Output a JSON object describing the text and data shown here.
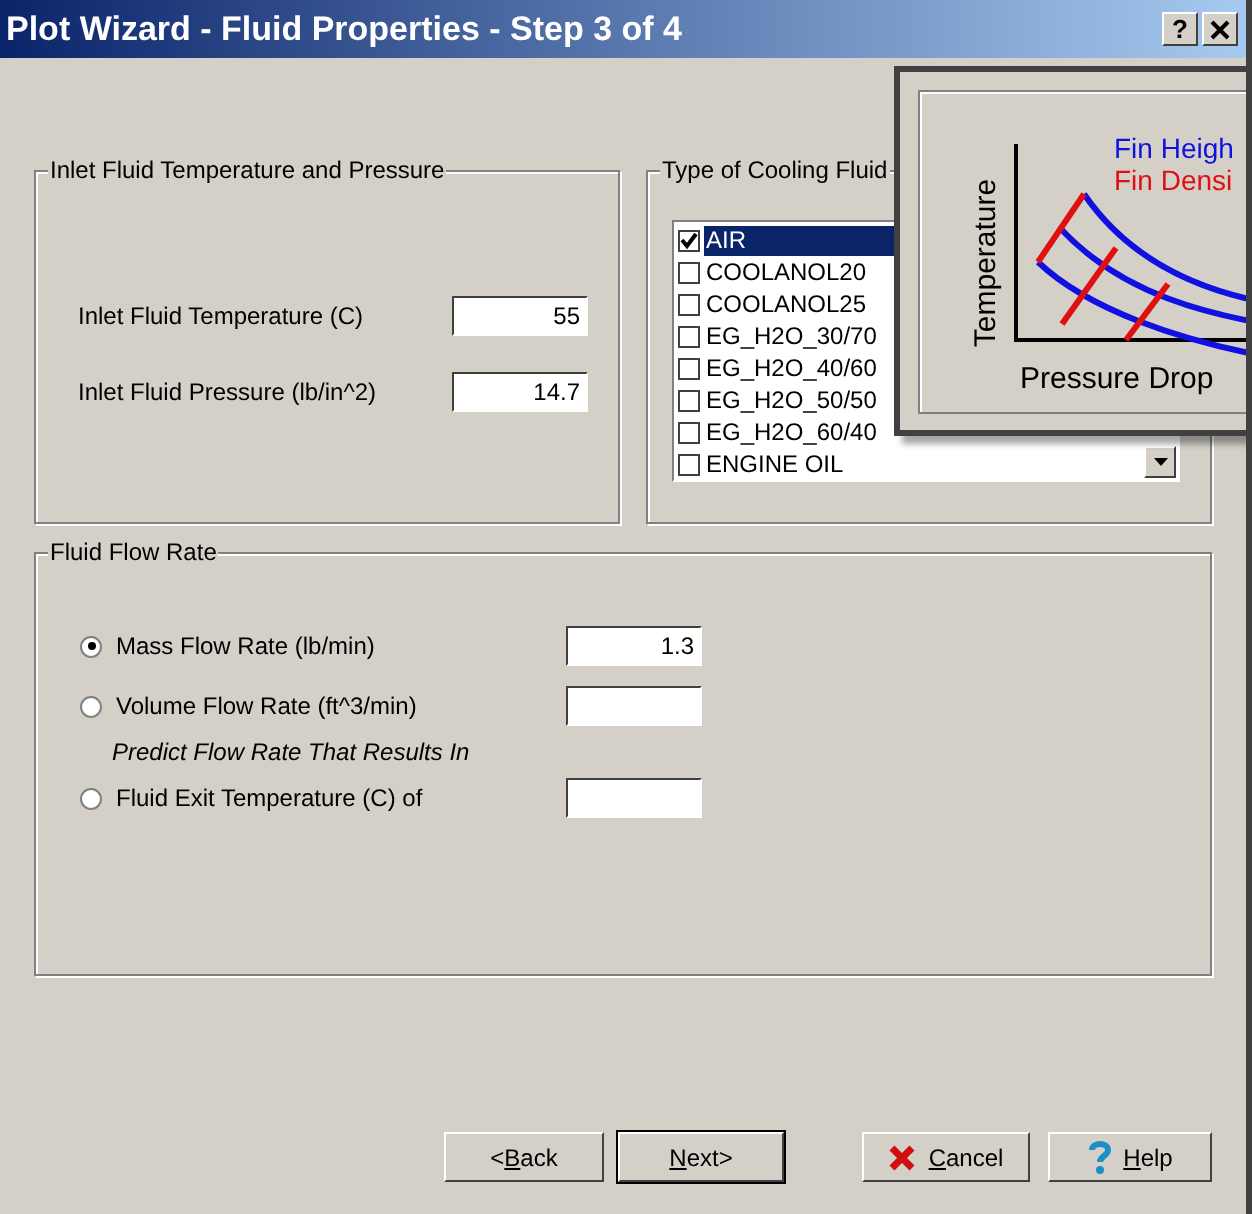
{
  "window": {
    "title": "Plot Wizard - Fluid Properties - Step 3 of 4",
    "help_button": "?"
  },
  "inlet": {
    "title": "Inlet Fluid Temperature and Pressure",
    "fields": [
      {
        "label": "Inlet Fluid Temperature (C)",
        "value": "55"
      },
      {
        "label": "Inlet Fluid Pressure (lb/in^2)",
        "value": "14.7"
      }
    ]
  },
  "cooling_fluid": {
    "title": "Type of Cooling Fluid",
    "items": [
      {
        "label": "AIR",
        "checked": true,
        "selected": true
      },
      {
        "label": "COOLANOL20",
        "checked": false,
        "selected": false
      },
      {
        "label": "COOLANOL25",
        "checked": false,
        "selected": false
      },
      {
        "label": "EG_H2O_30/70",
        "checked": false,
        "selected": false
      },
      {
        "label": "EG_H2O_40/60",
        "checked": false,
        "selected": false
      },
      {
        "label": "EG_H2O_50/50",
        "checked": false,
        "selected": false
      },
      {
        "label": "EG_H2O_60/40",
        "checked": false,
        "selected": false
      },
      {
        "label": "ENGINE OIL",
        "checked": false,
        "selected": false
      }
    ]
  },
  "flow_rate": {
    "title": "Fluid Flow Rate",
    "rows": [
      {
        "kind": "option",
        "label": "Mass Flow Rate (lb/min)",
        "selected": true,
        "value": "1.3"
      },
      {
        "kind": "option",
        "label": "Volume Flow Rate (ft^3/min)",
        "selected": false,
        "value": ""
      },
      {
        "kind": "note",
        "label": "Predict Flow Rate That Results In"
      },
      {
        "kind": "option",
        "label": "Fluid Exit Temperature (C) of",
        "selected": false,
        "value": ""
      }
    ]
  },
  "preview": {
    "y_label": "Temperature",
    "x_label": "Pressure Drop",
    "legend": [
      {
        "label": "Fin Heigh",
        "color": "#1010e0"
      },
      {
        "label": "Fin Densi",
        "color": "#e01010"
      }
    ]
  },
  "buttons": [
    {
      "pre": "<",
      "key": "B",
      "post": "ack",
      "kind": "plain",
      "default": false
    },
    {
      "key": "N",
      "post": "ext>",
      "kind": "plain",
      "default": true
    },
    {
      "key": "C",
      "post": "ancel",
      "kind": "cancel",
      "default": false
    },
    {
      "key": "H",
      "post": "elp",
      "kind": "help",
      "default": false
    }
  ]
}
